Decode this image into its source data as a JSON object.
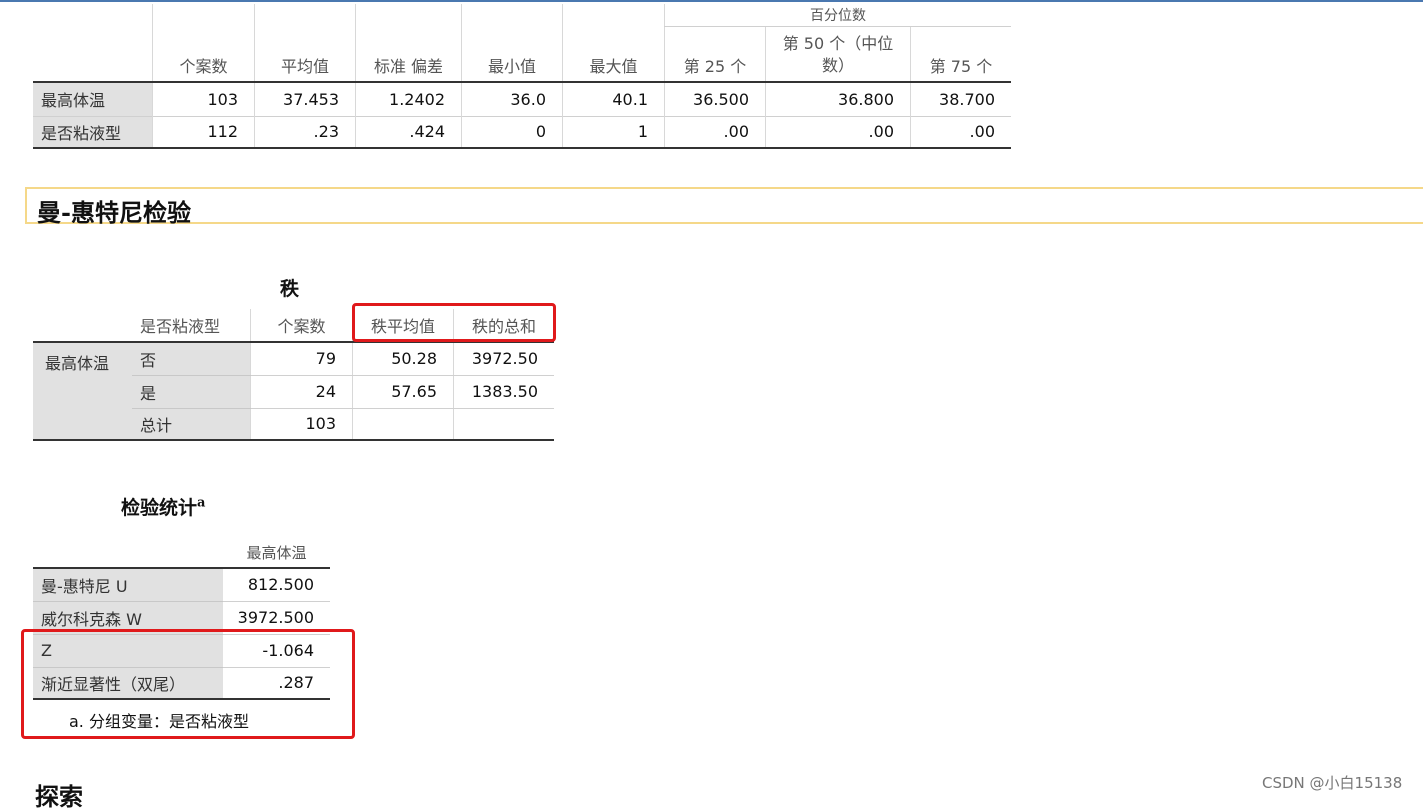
{
  "descriptives": {
    "percentile_group": "百分位数",
    "headers": [
      "个案数",
      "平均值",
      "标准 偏差",
      "最小值",
      "最大值",
      "第 25 个",
      "第 50 个（中位数）",
      "第 75 个"
    ],
    "rows": [
      {
        "label": "最高体温",
        "values": [
          "103",
          "37.453",
          "1.2402",
          "36.0",
          "40.1",
          "36.500",
          "36.800",
          "38.700"
        ]
      },
      {
        "label": "是否粘液型",
        "values": [
          "112",
          ".23",
          ".424",
          "0",
          "1",
          ".00",
          ".00",
          ".00"
        ]
      }
    ]
  },
  "mann_whitney": {
    "section_title": "曼-惠特尼检验",
    "ranks": {
      "title": "秩",
      "headers": {
        "group": "是否粘液型",
        "n": "个案数",
        "mean_rank": "秩平均值",
        "sum_ranks": "秩的总和"
      },
      "row_label": "最高体温",
      "rows": [
        {
          "group": "否",
          "n": "79",
          "mean_rank": "50.28",
          "sum_ranks": "3972.50"
        },
        {
          "group": "是",
          "n": "24",
          "mean_rank": "57.65",
          "sum_ranks": "1383.50"
        },
        {
          "group": "总计",
          "n": "103",
          "mean_rank": "",
          "sum_ranks": ""
        }
      ]
    },
    "test_stats": {
      "title": "检验统计",
      "title_sup": "a",
      "column": "最高体温",
      "rows": [
        {
          "label": "曼-惠特尼 U",
          "value": "812.500"
        },
        {
          "label": "威尔科克森 W",
          "value": "3972.500"
        },
        {
          "label": "Z",
          "value": "-1.064"
        },
        {
          "label": "渐近显著性（双尾）",
          "value": ".287"
        }
      ],
      "footnote": "a. 分组变量：是否粘液型"
    }
  },
  "next_section": "探索",
  "watermark": "CSDN @小白15138",
  "colors": {
    "highlight": "#e0191b",
    "section_border": "#f5d889",
    "row_label_bg": "#e1e1e1"
  }
}
